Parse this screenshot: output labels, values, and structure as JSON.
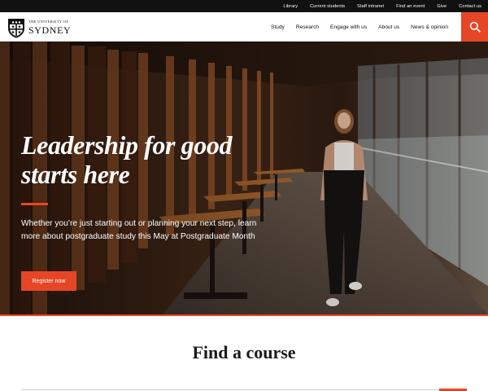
{
  "utility_nav": {
    "items": [
      "Library",
      "Current students",
      "Staff intranet",
      "Find an event",
      "Give",
      "Contact us"
    ]
  },
  "brand": {
    "line1": "THE UNIVERSITY OF",
    "line2": "SYDNEY"
  },
  "main_nav": {
    "items": [
      "Study",
      "Research",
      "Engage with us",
      "About us",
      "News & opinion"
    ],
    "search_icon": "search-icon"
  },
  "hero": {
    "title_line1": "Leadership for good",
    "title_line2": "starts here",
    "body": "Whether you’re just starting out or planning your next step, learn more about postgraduate study this May at Postgraduate Month",
    "cta_label": "Register now"
  },
  "find_course": {
    "title": "Find a course"
  },
  "colors": {
    "accent": "#e64626",
    "utility_bar": "#111111",
    "header_bg": "#ffffff"
  }
}
